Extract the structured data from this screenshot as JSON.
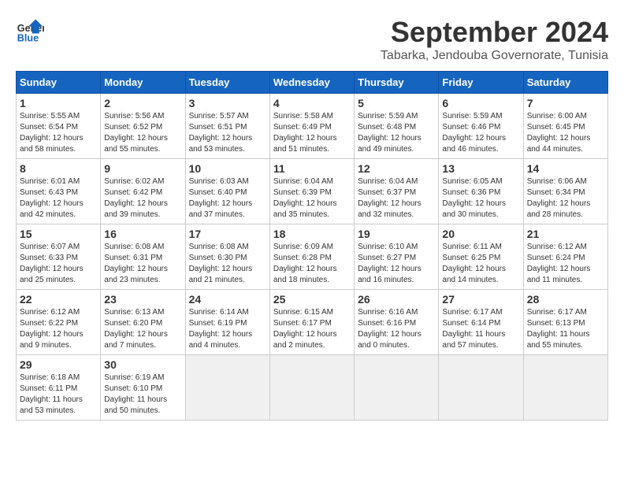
{
  "header": {
    "logo_line1": "General",
    "logo_line2": "Blue",
    "month": "September 2024",
    "location": "Tabarka, Jendouba Governorate, Tunisia"
  },
  "weekdays": [
    "Sunday",
    "Monday",
    "Tuesday",
    "Wednesday",
    "Thursday",
    "Friday",
    "Saturday"
  ],
  "weeks": [
    [
      {
        "day": "1",
        "text": "Sunrise: 5:55 AM\nSunset: 6:54 PM\nDaylight: 12 hours\nand 58 minutes."
      },
      {
        "day": "2",
        "text": "Sunrise: 5:56 AM\nSunset: 6:52 PM\nDaylight: 12 hours\nand 55 minutes."
      },
      {
        "day": "3",
        "text": "Sunrise: 5:57 AM\nSunset: 6:51 PM\nDaylight: 12 hours\nand 53 minutes."
      },
      {
        "day": "4",
        "text": "Sunrise: 5:58 AM\nSunset: 6:49 PM\nDaylight: 12 hours\nand 51 minutes."
      },
      {
        "day": "5",
        "text": "Sunrise: 5:59 AM\nSunset: 6:48 PM\nDaylight: 12 hours\nand 49 minutes."
      },
      {
        "day": "6",
        "text": "Sunrise: 5:59 AM\nSunset: 6:46 PM\nDaylight: 12 hours\nand 46 minutes."
      },
      {
        "day": "7",
        "text": "Sunrise: 6:00 AM\nSunset: 6:45 PM\nDaylight: 12 hours\nand 44 minutes."
      }
    ],
    [
      {
        "day": "8",
        "text": "Sunrise: 6:01 AM\nSunset: 6:43 PM\nDaylight: 12 hours\nand 42 minutes."
      },
      {
        "day": "9",
        "text": "Sunrise: 6:02 AM\nSunset: 6:42 PM\nDaylight: 12 hours\nand 39 minutes."
      },
      {
        "day": "10",
        "text": "Sunrise: 6:03 AM\nSunset: 6:40 PM\nDaylight: 12 hours\nand 37 minutes."
      },
      {
        "day": "11",
        "text": "Sunrise: 6:04 AM\nSunset: 6:39 PM\nDaylight: 12 hours\nand 35 minutes."
      },
      {
        "day": "12",
        "text": "Sunrise: 6:04 AM\nSunset: 6:37 PM\nDaylight: 12 hours\nand 32 minutes."
      },
      {
        "day": "13",
        "text": "Sunrise: 6:05 AM\nSunset: 6:36 PM\nDaylight: 12 hours\nand 30 minutes."
      },
      {
        "day": "14",
        "text": "Sunrise: 6:06 AM\nSunset: 6:34 PM\nDaylight: 12 hours\nand 28 minutes."
      }
    ],
    [
      {
        "day": "15",
        "text": "Sunrise: 6:07 AM\nSunset: 6:33 PM\nDaylight: 12 hours\nand 25 minutes."
      },
      {
        "day": "16",
        "text": "Sunrise: 6:08 AM\nSunset: 6:31 PM\nDaylight: 12 hours\nand 23 minutes."
      },
      {
        "day": "17",
        "text": "Sunrise: 6:08 AM\nSunset: 6:30 PM\nDaylight: 12 hours\nand 21 minutes."
      },
      {
        "day": "18",
        "text": "Sunrise: 6:09 AM\nSunset: 6:28 PM\nDaylight: 12 hours\nand 18 minutes."
      },
      {
        "day": "19",
        "text": "Sunrise: 6:10 AM\nSunset: 6:27 PM\nDaylight: 12 hours\nand 16 minutes."
      },
      {
        "day": "20",
        "text": "Sunrise: 6:11 AM\nSunset: 6:25 PM\nDaylight: 12 hours\nand 14 minutes."
      },
      {
        "day": "21",
        "text": "Sunrise: 6:12 AM\nSunset: 6:24 PM\nDaylight: 12 hours\nand 11 minutes."
      }
    ],
    [
      {
        "day": "22",
        "text": "Sunrise: 6:12 AM\nSunset: 6:22 PM\nDaylight: 12 hours\nand 9 minutes."
      },
      {
        "day": "23",
        "text": "Sunrise: 6:13 AM\nSunset: 6:20 PM\nDaylight: 12 hours\nand 7 minutes."
      },
      {
        "day": "24",
        "text": "Sunrise: 6:14 AM\nSunset: 6:19 PM\nDaylight: 12 hours\nand 4 minutes."
      },
      {
        "day": "25",
        "text": "Sunrise: 6:15 AM\nSunset: 6:17 PM\nDaylight: 12 hours\nand 2 minutes."
      },
      {
        "day": "26",
        "text": "Sunrise: 6:16 AM\nSunset: 6:16 PM\nDaylight: 12 hours\nand 0 minutes."
      },
      {
        "day": "27",
        "text": "Sunrise: 6:17 AM\nSunset: 6:14 PM\nDaylight: 11 hours\nand 57 minutes."
      },
      {
        "day": "28",
        "text": "Sunrise: 6:17 AM\nSunset: 6:13 PM\nDaylight: 11 hours\nand 55 minutes."
      }
    ],
    [
      {
        "day": "29",
        "text": "Sunrise: 6:18 AM\nSunset: 6:11 PM\nDaylight: 11 hours\nand 53 minutes."
      },
      {
        "day": "30",
        "text": "Sunrise: 6:19 AM\nSunset: 6:10 PM\nDaylight: 11 hours\nand 50 minutes."
      },
      {
        "day": "",
        "text": ""
      },
      {
        "day": "",
        "text": ""
      },
      {
        "day": "",
        "text": ""
      },
      {
        "day": "",
        "text": ""
      },
      {
        "day": "",
        "text": ""
      }
    ]
  ]
}
